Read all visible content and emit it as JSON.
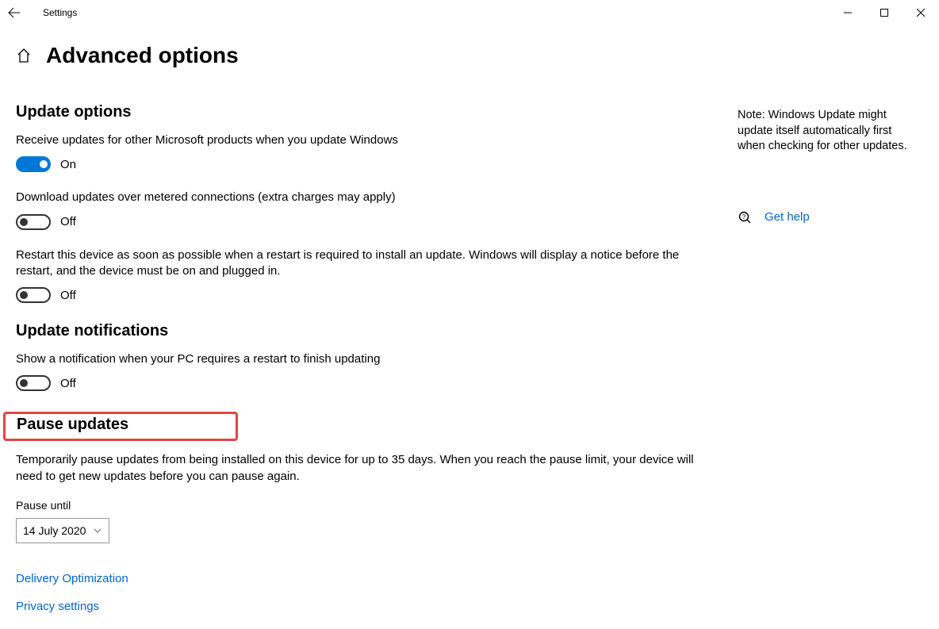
{
  "window": {
    "title": "Settings"
  },
  "page": {
    "heading": "Advanced options"
  },
  "sections": {
    "update_options": {
      "heading": "Update options",
      "opt1": {
        "label": "Receive updates for other Microsoft products when you update Windows",
        "state": "On"
      },
      "opt2": {
        "label": "Download updates over metered connections (extra charges may apply)",
        "state": "Off"
      },
      "opt3": {
        "label": "Restart this device as soon as possible when a restart is required to install an update. Windows will display a notice before the restart, and the device must be on and plugged in.",
        "state": "Off"
      }
    },
    "update_notifications": {
      "heading": "Update notifications",
      "opt1": {
        "label": "Show a notification when your PC requires a restart to finish updating",
        "state": "Off"
      }
    },
    "pause": {
      "heading": "Pause updates",
      "description": "Temporarily pause updates from being installed on this device for up to 35 days. When you reach the pause limit, your device will need to get new updates before you can pause again.",
      "dropdown_label": "Pause until",
      "dropdown_value": "14 July 2020"
    }
  },
  "links": {
    "delivery": "Delivery Optimization",
    "privacy": "Privacy settings"
  },
  "side": {
    "note": "Note: Windows Update might update itself automatically first when checking for other updates.",
    "help": "Get help"
  }
}
